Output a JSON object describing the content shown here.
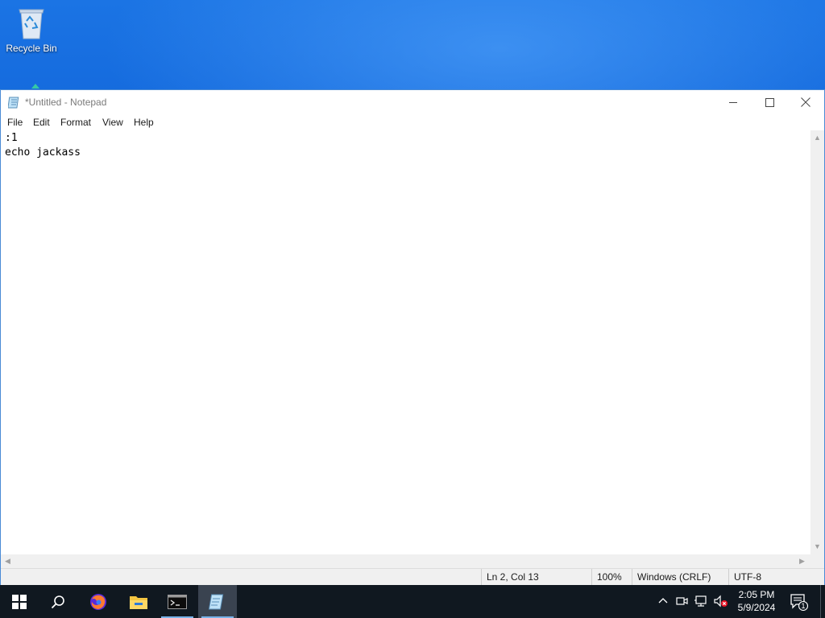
{
  "desktop": {
    "recycle_bin_label": "Recycle Bin"
  },
  "window": {
    "title": "*Untitled - Notepad",
    "menu": [
      "File",
      "Edit",
      "Format",
      "View",
      "Help"
    ],
    "editor_lines": [
      ":1",
      "echo jackass"
    ],
    "status": {
      "position": "Ln 2, Col 13",
      "zoom": "100%",
      "line_endings": "Windows (CRLF)",
      "encoding": "UTF-8"
    }
  },
  "taskbar": {
    "apps": [
      "start-icon",
      "search-icon",
      "firefox-icon",
      "file-explorer-icon",
      "terminal-icon",
      "notepad-icon"
    ],
    "active_app": "notepad",
    "clock_time": "2:05 PM",
    "clock_date": "5/9/2024",
    "notification_count": "1"
  },
  "colors": {
    "desktop_blue": "#0a5bd3",
    "taskbar": "#101820",
    "accent": "#78b2e8"
  }
}
